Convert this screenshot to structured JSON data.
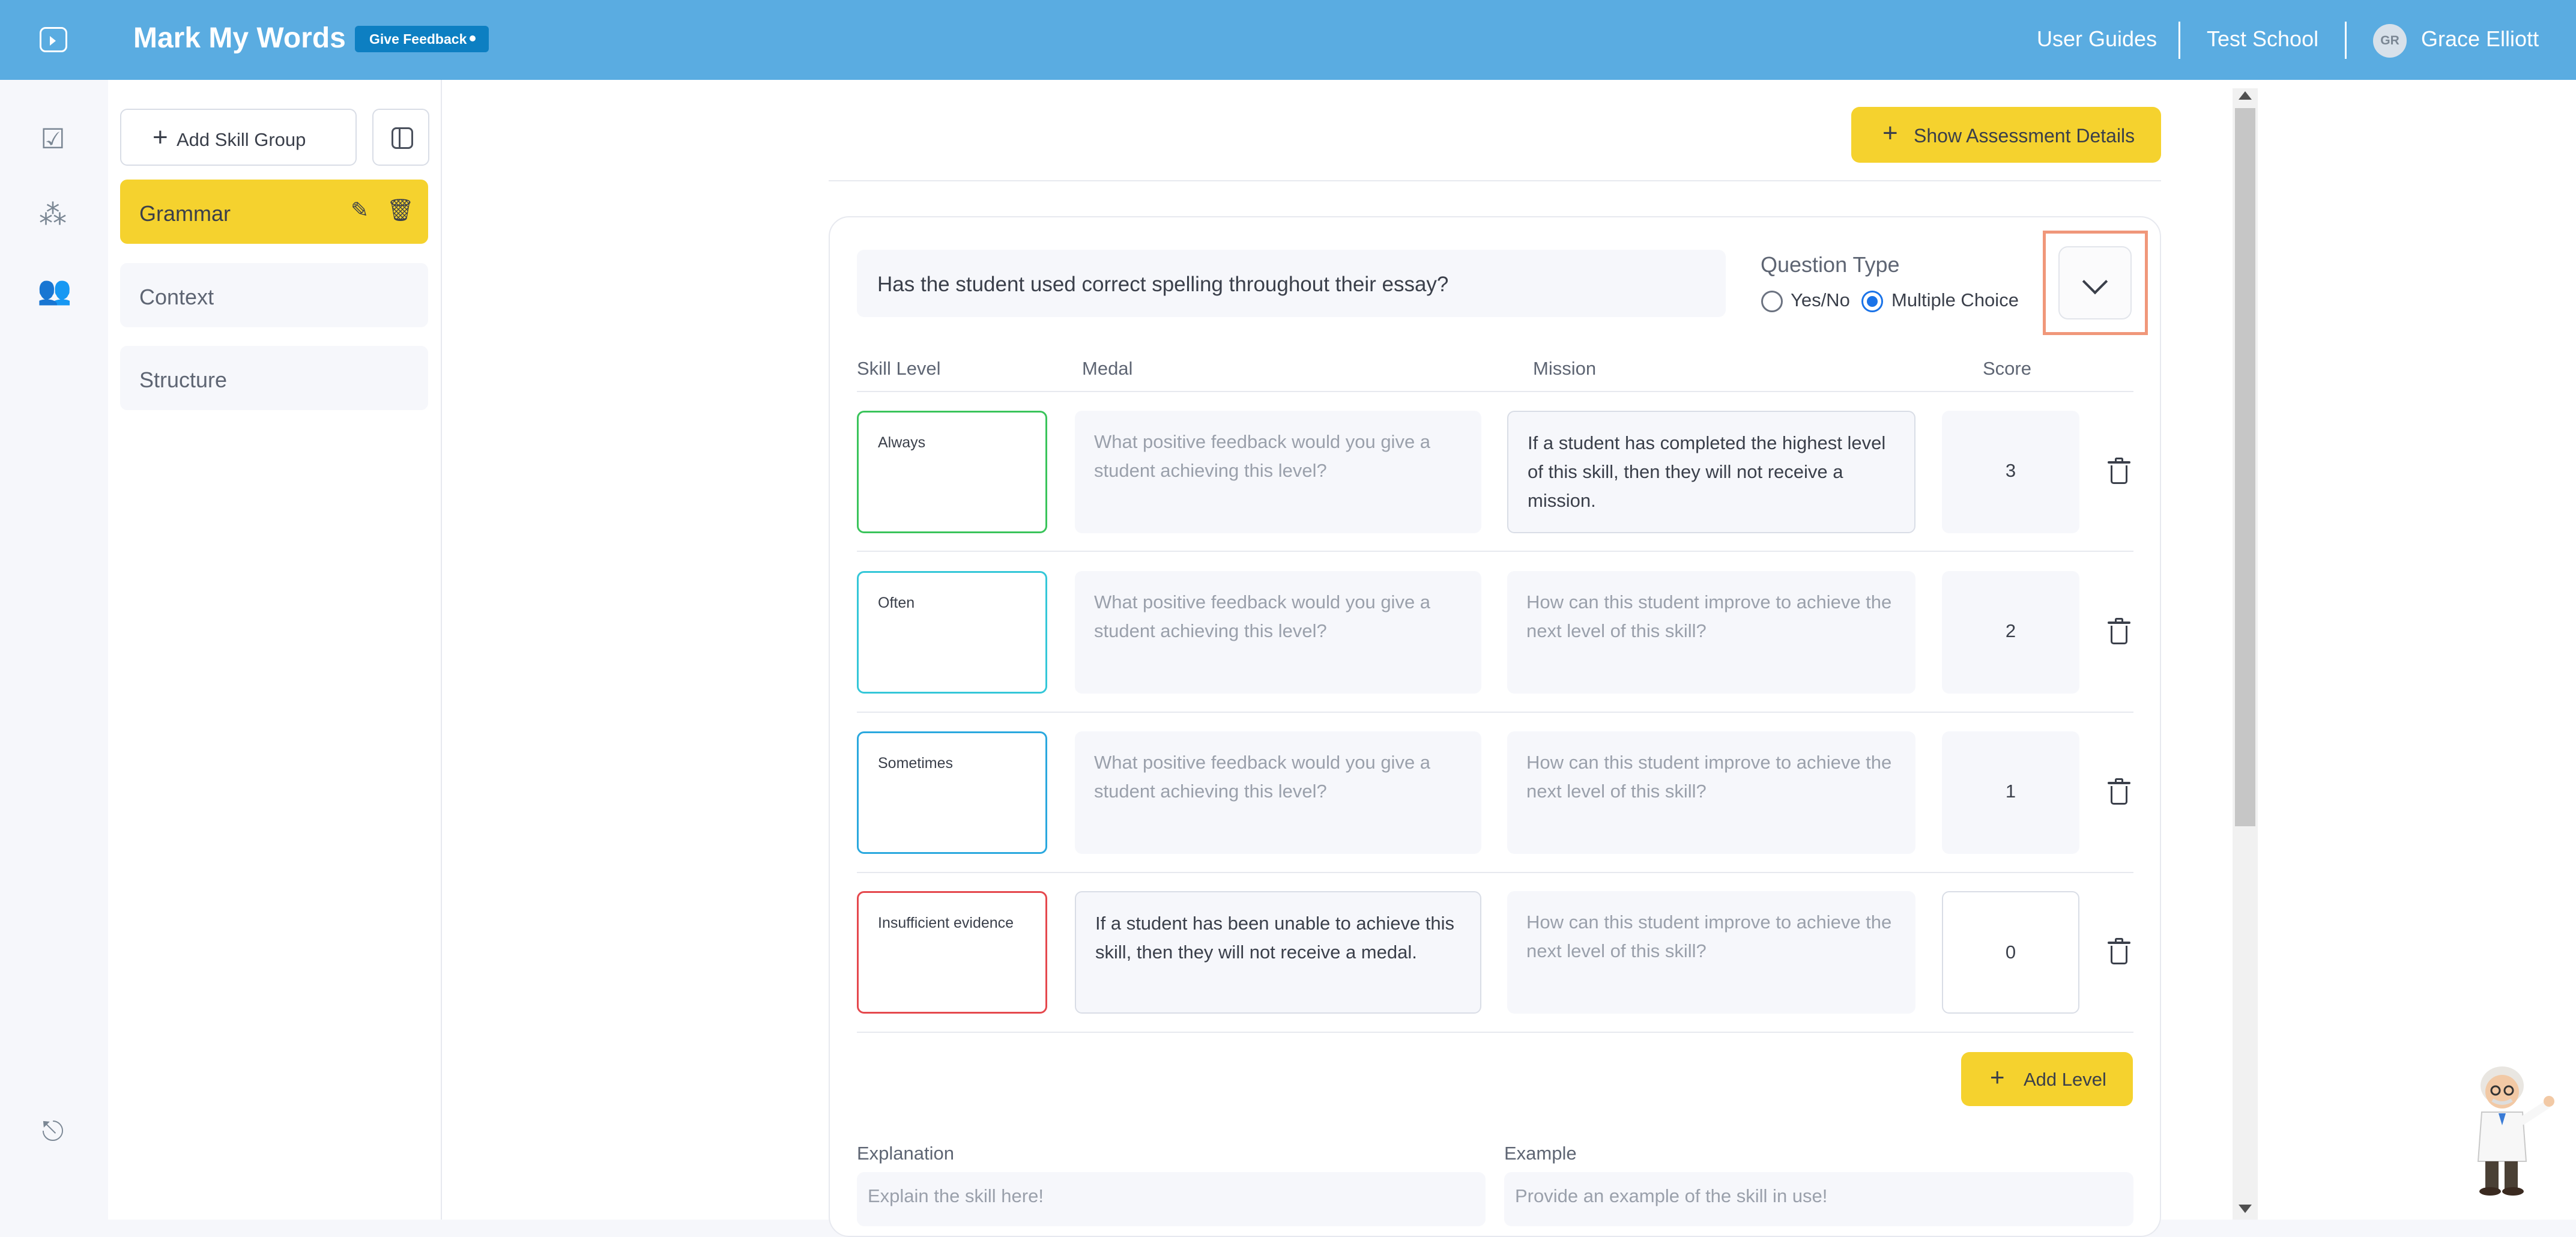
{
  "header": {
    "title": "Mark My Words",
    "feedback_badge": "Give Feedback",
    "nav": {
      "user_guides": "User Guides",
      "school": "Test School",
      "user_initials": "GR",
      "user_name": "Grace Elliott"
    }
  },
  "sidebar_rail": {
    "icons": [
      "assessments-icon",
      "groups-icon",
      "users-icon",
      "logout-icon"
    ]
  },
  "skill_panel": {
    "add_group_label": "Add Skill Group",
    "groups": [
      {
        "label": "Grammar",
        "active": true
      },
      {
        "label": "Context",
        "active": false
      },
      {
        "label": "Structure",
        "active": false
      }
    ]
  },
  "toolbar": {
    "show_details_label": "Show Assessment Details"
  },
  "question": {
    "text": "Has the student used correct spelling throughout their essay?",
    "type_label": "Question Type",
    "options": [
      {
        "label": "Yes/No",
        "selected": false
      },
      {
        "label": "Multiple Choice",
        "selected": true
      }
    ]
  },
  "table": {
    "headers": {
      "skill_level": "Skill Level",
      "medal": "Medal",
      "mission": "Mission",
      "score": "Score"
    },
    "rows": [
      {
        "level": "Always",
        "level_color": "#3ac45b",
        "medal": "What positive feedback would you give a student achieving this level?",
        "medal_is_placeholder": true,
        "mission": "If a student has completed the highest level of this skill, then they will not receive a mission.",
        "mission_is_placeholder": false,
        "score": "3"
      },
      {
        "level": "Often",
        "level_color": "#34c7d8",
        "medal": "What positive feedback would you give a student achieving this level?",
        "medal_is_placeholder": true,
        "mission": "How can this student improve to achieve the next level of this skill?",
        "mission_is_placeholder": true,
        "score": "2"
      },
      {
        "level": "Sometimes",
        "level_color": "#2aa8de",
        "medal": "What positive feedback would you give a student achieving this level?",
        "medal_is_placeholder": true,
        "mission": "How can this student improve to achieve the next level of this skill?",
        "mission_is_placeholder": true,
        "score": "1"
      },
      {
        "level": "Insufficient evidence",
        "level_color": "#e5484d",
        "medal": "If a student has been unable to achieve this skill, then they will not receive a medal.",
        "medal_is_placeholder": false,
        "mission": "How can this student improve to achieve the next level of this skill?",
        "mission_is_placeholder": true,
        "score": "0"
      }
    ]
  },
  "add_level_label": "Add Level",
  "explanation": {
    "label": "Explanation",
    "placeholder": "Explain the skill here!"
  },
  "example": {
    "label": "Example",
    "placeholder": "Provide an example of the skill in use!"
  },
  "colors": {
    "topbar": "#5aace1",
    "accent_yellow": "#f5d22e",
    "badge_blue": "#0d7fc2",
    "radio_blue": "#1a73e8",
    "focus_highlight": "#f0977a"
  }
}
